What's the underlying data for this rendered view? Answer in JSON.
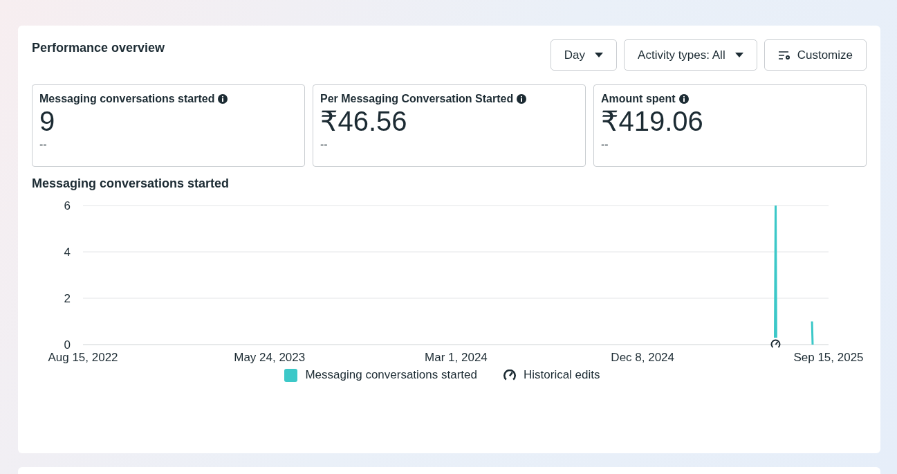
{
  "panel": {
    "title": "Performance overview",
    "controls": [
      {
        "label": "Day",
        "kind": "dropdown"
      },
      {
        "label": "Activity types: All",
        "kind": "dropdown"
      },
      {
        "label": "Customize",
        "kind": "customize"
      }
    ],
    "metrics": [
      {
        "label": "Messaging conversations started",
        "value": "9",
        "change": "--"
      },
      {
        "label": "Per Messaging Conversation Started",
        "value": "₹46.56",
        "change": "--"
      },
      {
        "label": "Amount spent",
        "value": "₹419.06",
        "change": "--"
      }
    ],
    "chart_title": "Messaging conversations started",
    "chart_data": {
      "type": "line",
      "xlim": [
        "2022-08-15",
        "2025-09-15"
      ],
      "ylim": [
        0,
        6
      ],
      "yticks": [
        0,
        2,
        4,
        6
      ],
      "xticks": [
        {
          "value": "2022-08-15",
          "label": "Aug 15, 2022"
        },
        {
          "value": "2023-05-24",
          "label": "May 24, 2023"
        },
        {
          "value": "2024-03-01",
          "label": "Mar 1, 2024"
        },
        {
          "value": "2024-12-08",
          "label": "Dec 8, 2024"
        },
        {
          "value": "2025-09-15",
          "label": "Sep 15, 2025"
        }
      ],
      "x": [
        "2025-06-26",
        "2025-06-27",
        "2025-06-28",
        "2025-08-20",
        "2025-08-21",
        "2025-08-22"
      ],
      "series": [
        {
          "name": "Messaging conversations started",
          "color": "#3cc8c8",
          "values": [
            0.3,
            6,
            0.3,
            null,
            1,
            0
          ]
        }
      ]
    },
    "edits_legend": "Historical edits"
  }
}
